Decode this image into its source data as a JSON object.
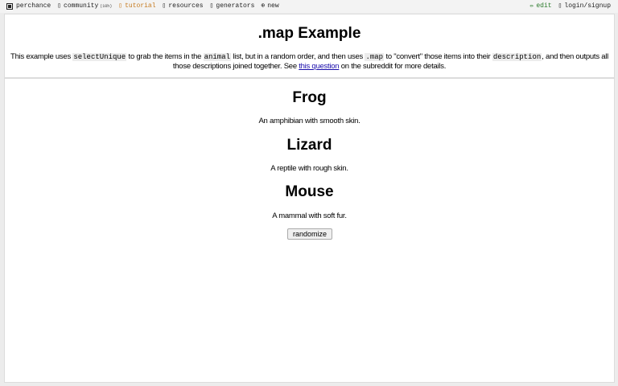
{
  "nav": {
    "brand": "perchance",
    "community": "community",
    "community_badge": "(10h)",
    "tutorial": "tutorial",
    "resources": "resources",
    "generators": "generators",
    "new": "new",
    "edit": "edit",
    "login": "login/signup"
  },
  "header": {
    "title": ".map Example",
    "desc": {
      "t1": "This example uses ",
      "c1": "selectUnique",
      "t2": " to grab the items in the ",
      "c2": "animal",
      "t3": " list, but in a random order, and then uses ",
      "c3": ".map",
      "t4": " to \"convert\" those items into their ",
      "c4": "description",
      "t5": ", and then outputs all those descriptions joined together. See ",
      "link": "this question",
      "t6": " on the subreddit for more details."
    }
  },
  "output": {
    "animals": [
      {
        "name": "Frog",
        "description": "An amphibian with smooth skin."
      },
      {
        "name": "Lizard",
        "description": "A reptile with rough skin."
      },
      {
        "name": "Mouse",
        "description": "A mammal with soft fur."
      }
    ],
    "button_label": "randomize"
  },
  "colors": {
    "tutorial": "#c67a1e",
    "edit": "#2a7a2a",
    "link": "#1a0dab"
  },
  "icons": {
    "brand": "dice-icon",
    "community": "chat-icon",
    "tutorial": "book-icon",
    "resources": "link-icon",
    "generators": "list-icon",
    "new": "plus-circle-icon",
    "edit": "pencil-icon",
    "login": "user-icon"
  }
}
